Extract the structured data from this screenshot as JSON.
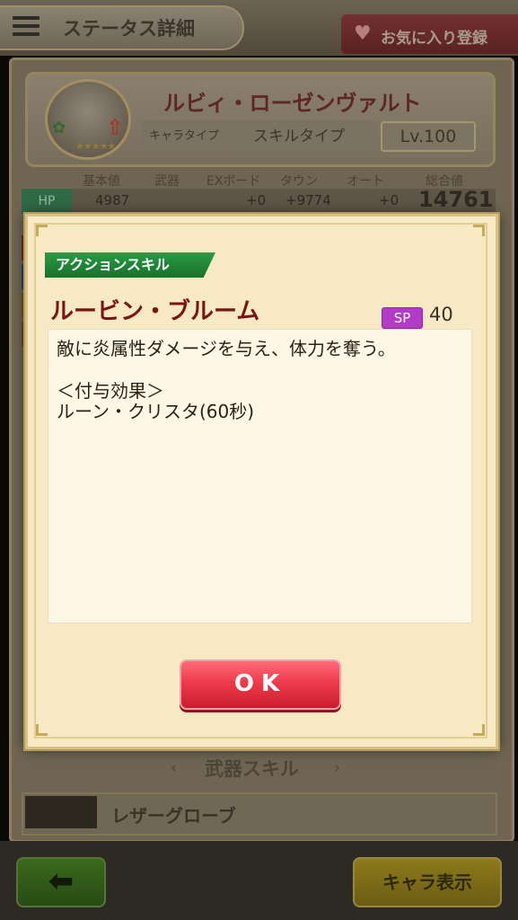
{
  "header": {
    "title": "ステータス詳細",
    "favorite_label": "お気に入り登録"
  },
  "character": {
    "name": "ルビィ・ローゼンヴァルト",
    "chara_type": "キャラタイプ",
    "skill_type": "スキルタイプ",
    "level": "Lv.100"
  },
  "stats": {
    "headers": [
      "基本値",
      "武器",
      "EXボード",
      "タウン",
      "オート",
      "総合値"
    ],
    "hp": {
      "label": "HP",
      "base": "4987",
      "ex_board": "+0",
      "town": "+9774",
      "auto": "+0",
      "total": "14761"
    }
  },
  "weapon_section": {
    "title": "武器スキル",
    "weapon_name": "レザーグローブ"
  },
  "footer": {
    "back_icon": "left-arrow-icon",
    "chara_button": "キャラ表示"
  },
  "dialog": {
    "tag": "アクションスキル",
    "skill_name": "ルービン・ブルーム",
    "sp_label": "SP",
    "sp_value": "40",
    "description": [
      "敵に炎属性ダメージを与え、体力を奪う。",
      "＜付与効果＞",
      "ルーン・クリスタ(60秒)"
    ],
    "ok_label": "OK"
  }
}
